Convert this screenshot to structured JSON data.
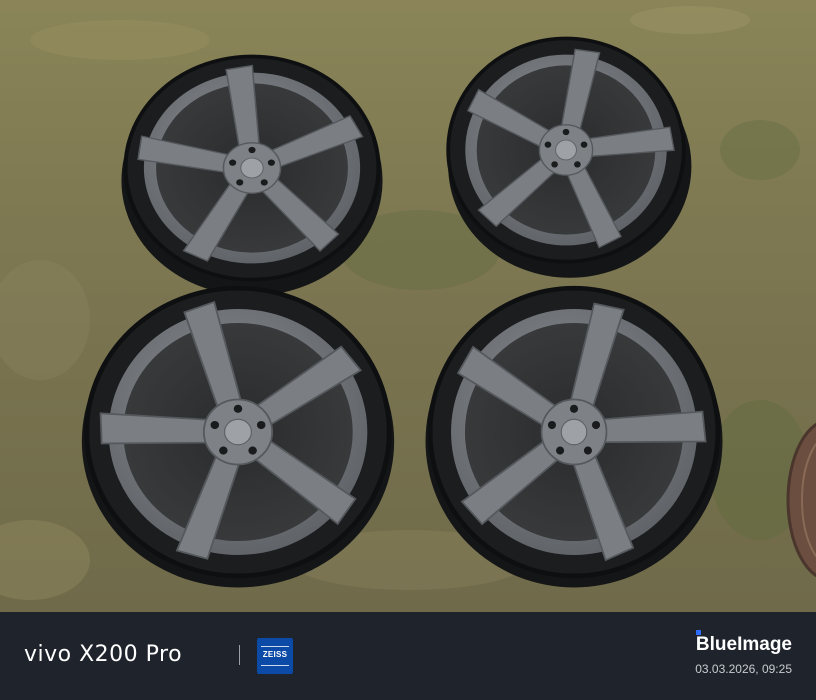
{
  "photo": {
    "subject": "four-wheels-on-grass",
    "wheel_count": 4
  },
  "watermark": {
    "device": "vivo X200 Pro",
    "lens_brand": "ZEISS",
    "app_brand": "BlueImage",
    "datetime": "03.03.2026, 09:25"
  },
  "colors": {
    "grass": "#7c7650",
    "tire": "#1c1d1f",
    "rim": "#6d7176",
    "footer": "#1f232b",
    "zeiss_blue": "#0b4aa6"
  }
}
